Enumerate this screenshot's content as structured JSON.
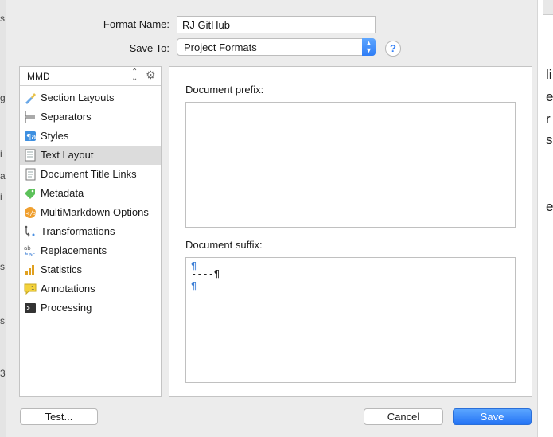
{
  "form": {
    "format_name_label": "Format Name:",
    "format_name_value": "RJ GitHub",
    "save_to_label": "Save To:",
    "save_to_value": "Project Formats",
    "help_glyph": "?"
  },
  "sidebar": {
    "header": "MMD",
    "items": [
      {
        "label": "Section Layouts",
        "icon": "brush-icon"
      },
      {
        "label": "Separators",
        "icon": "separator-icon"
      },
      {
        "label": "Styles",
        "icon": "pilcrow-style-icon"
      },
      {
        "label": "Text Layout",
        "icon": "text-layout-icon",
        "selected": true
      },
      {
        "label": "Document Title Links",
        "icon": "document-icon"
      },
      {
        "label": "Metadata",
        "icon": "tag-icon"
      },
      {
        "label": "MultiMarkdown Options",
        "icon": "code-badge-icon"
      },
      {
        "label": "Transformations",
        "icon": "transform-icon"
      },
      {
        "label": "Replacements",
        "icon": "replace-ab-icon"
      },
      {
        "label": "Statistics",
        "icon": "bar-chart-icon"
      },
      {
        "label": "Annotations",
        "icon": "annotation-icon"
      },
      {
        "label": "Processing",
        "icon": "terminal-icon"
      }
    ]
  },
  "panel": {
    "prefix_label": "Document prefix:",
    "suffix_label": "Document suffix:",
    "suffix_lines": [
      "¶",
      "----¶",
      "¶"
    ]
  },
  "buttons": {
    "test": "Test...",
    "cancel": "Cancel",
    "save": "Save"
  },
  "background": {
    "left_fragments": [
      "s",
      "g",
      "i",
      "a",
      "i",
      "s",
      "s",
      "3"
    ],
    "right_fragments": [
      "li",
      "e",
      "r",
      "s",
      "e"
    ]
  },
  "colors": {
    "accent": "#2f7df6",
    "pilcrow": "#3d7fd6",
    "selected_row": "#dcdcdc"
  }
}
